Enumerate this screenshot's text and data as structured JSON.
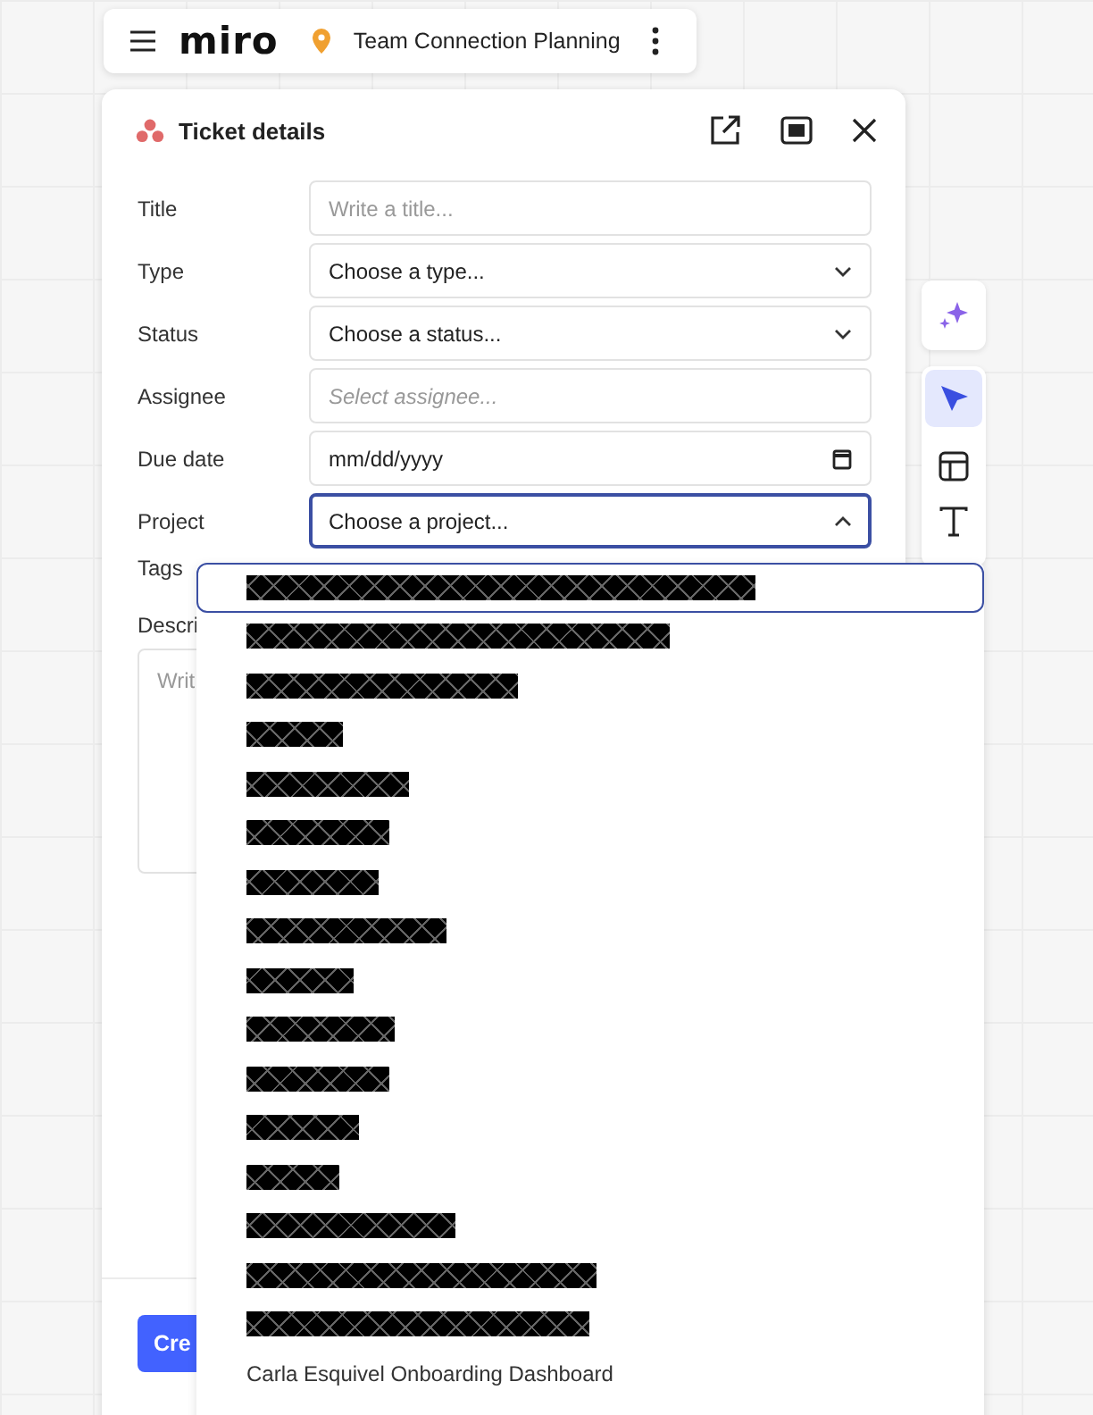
{
  "top_bar": {
    "logo": "miro",
    "board_title": "Team Connection Planning"
  },
  "panel": {
    "title": "Ticket details",
    "fields": [
      {
        "label": "Title",
        "kind": "text",
        "placeholder": "Write a title...",
        "expanded": false
      },
      {
        "label": "Type",
        "kind": "select",
        "value": "Choose a type...",
        "expanded": false
      },
      {
        "label": "Status",
        "kind": "select",
        "value": "Choose a status...",
        "expanded": false
      },
      {
        "label": "Assignee",
        "kind": "picker",
        "placeholder": "Select assignee...",
        "expanded": false
      },
      {
        "label": "Due date",
        "kind": "date",
        "value": "mm/dd/yyyy",
        "expanded": false
      },
      {
        "label": "Project",
        "kind": "select",
        "value": "Choose a project...",
        "expanded": true
      }
    ],
    "tags_label": "Tags",
    "description_label": "Descri",
    "description_placeholder": "Writ",
    "create_button": "Cre"
  },
  "project_options": [
    {
      "kind": "redacted",
      "selected": true
    },
    {
      "kind": "redacted",
      "selected": false
    },
    {
      "kind": "redacted",
      "selected": false
    },
    {
      "kind": "redacted",
      "selected": false
    },
    {
      "kind": "redacted",
      "selected": false
    },
    {
      "kind": "redacted",
      "selected": false
    },
    {
      "kind": "redacted",
      "selected": false
    },
    {
      "kind": "redacted",
      "selected": false
    },
    {
      "kind": "redacted",
      "selected": false
    },
    {
      "kind": "redacted",
      "selected": false
    },
    {
      "kind": "redacted",
      "selected": false
    },
    {
      "kind": "redacted",
      "selected": false
    },
    {
      "kind": "redacted",
      "selected": false
    },
    {
      "kind": "redacted",
      "selected": false
    },
    {
      "kind": "redacted",
      "selected": false
    },
    {
      "kind": "redacted",
      "selected": false
    },
    {
      "kind": "text",
      "label": "Carla Esquivel Onboarding Dashboard",
      "selected": false
    }
  ]
}
